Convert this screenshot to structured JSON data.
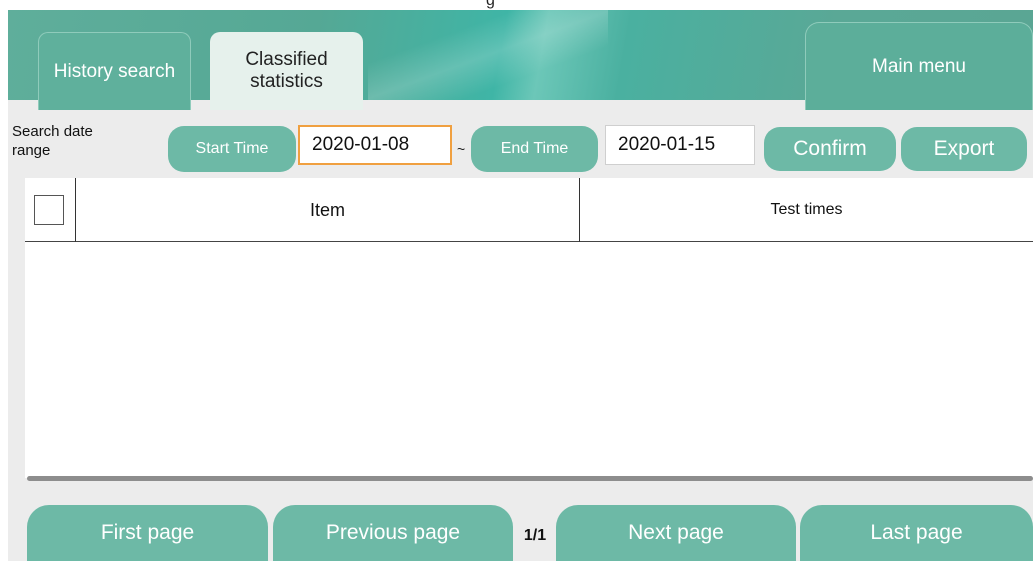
{
  "header": {
    "title_fragment": "g",
    "tabs": [
      {
        "label": "History search"
      },
      {
        "label": "Classified statistics"
      }
    ],
    "main_menu_label": "Main menu"
  },
  "search": {
    "range_label": "Search date range",
    "start_button": "Start Time",
    "start_value": "2020-01-08",
    "separator": "~",
    "end_button": "End Time",
    "end_value": "2020-01-15",
    "confirm_label": "Confirm",
    "export_label": "Export"
  },
  "table": {
    "columns": [
      "Item",
      "Test times"
    ],
    "rows": []
  },
  "pagination": {
    "first_label": "First page",
    "prev_label": "Previous page",
    "page_indicator": "1/1",
    "next_label": "Next page",
    "last_label": "Last page"
  },
  "colors": {
    "accent": "#6db9a6",
    "header": "#5aa894",
    "focus": "#f0a040"
  }
}
